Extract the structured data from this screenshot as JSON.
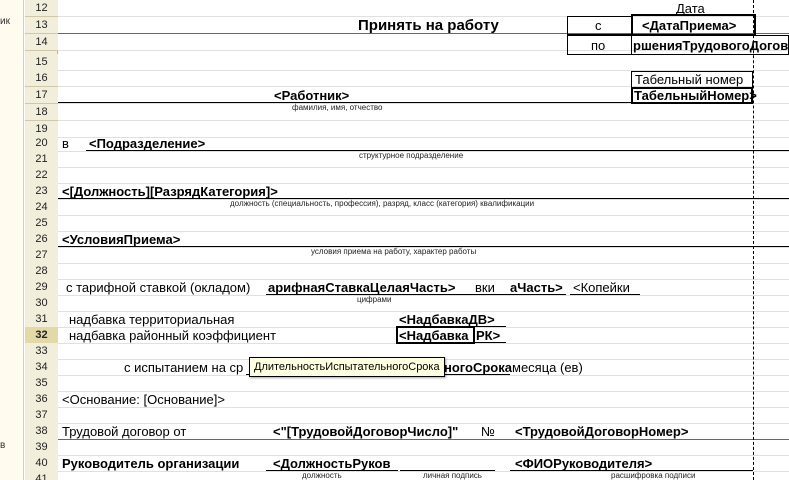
{
  "left_strip": {
    "top_label": "ик",
    "bottom_label": "в"
  },
  "rows": [
    "12",
    "13",
    "14",
    "15",
    "16",
    "17",
    "18",
    "19",
    "20",
    "21",
    "22",
    "23",
    "24",
    "25",
    "26",
    "27",
    "28",
    "29",
    "30",
    "31",
    "32",
    "33",
    "34",
    "35",
    "36",
    "37",
    "38",
    "39",
    "40",
    "41"
  ],
  "header": {
    "date_label": "Дата",
    "title": "Принять на работу",
    "from_label": "с",
    "to_label": "по",
    "start_date": "<ДатаПриема>",
    "end_date": "ршенияТрудовогоДогов",
    "tabnum_label": "Табельный номер",
    "tabnum_value": "ТабельныйНомер>"
  },
  "employee": {
    "value": "<Работник>",
    "caption": "фамилия, имя, отчество"
  },
  "department": {
    "prefix": "в",
    "value": "<Подразделение>",
    "caption": "структурное подразделение"
  },
  "position": {
    "value": "<[Должность][РазрядКатегория]>",
    "caption": "должность (специальность, профессия), разряд, класс (категория) квалификации"
  },
  "conditions": {
    "value": "<УсловияПриема>",
    "caption": "условия приема на работу, характер работы"
  },
  "salary": {
    "label": "с тарифной ставкой (окладом)",
    "whole": "арифнаяСтавкаЦелаяЧасть>",
    "mid": "вки",
    "frac": "аЧасть>",
    "kopeks": "<Копейки",
    "caption": "цифрами"
  },
  "allowances": {
    "territorial_label": "надбавка территориальная",
    "territorial_value": "<НадбавкаДВ>",
    "regional_label": "надбавка районный коэффициент",
    "regional_cell": "<Надбавка",
    "regional_tail": "РК>"
  },
  "probation": {
    "label": "с испытанием на ср",
    "value_tail": "ногоСрока",
    "suffix": "месяца (ев)",
    "tooltip": "ДлительностьИспытательногоСрока"
  },
  "basis": {
    "value": "<Основание: [Основание]>"
  },
  "contract": {
    "label": "Трудовой договор от",
    "number_value": "<\"[ТрудовойДоговорЧисло]\"",
    "number_sign": "№",
    "contract_number": "<ТрудовойДоговорНомер>"
  },
  "signature": {
    "label": "Руководитель организации",
    "position_value": "<ДолжностьРуков",
    "name_value": "<ФИОРуководителя>",
    "caption_position": "должность",
    "caption_sign": "личная подпись",
    "caption_decode": "расшифровка подписи"
  }
}
